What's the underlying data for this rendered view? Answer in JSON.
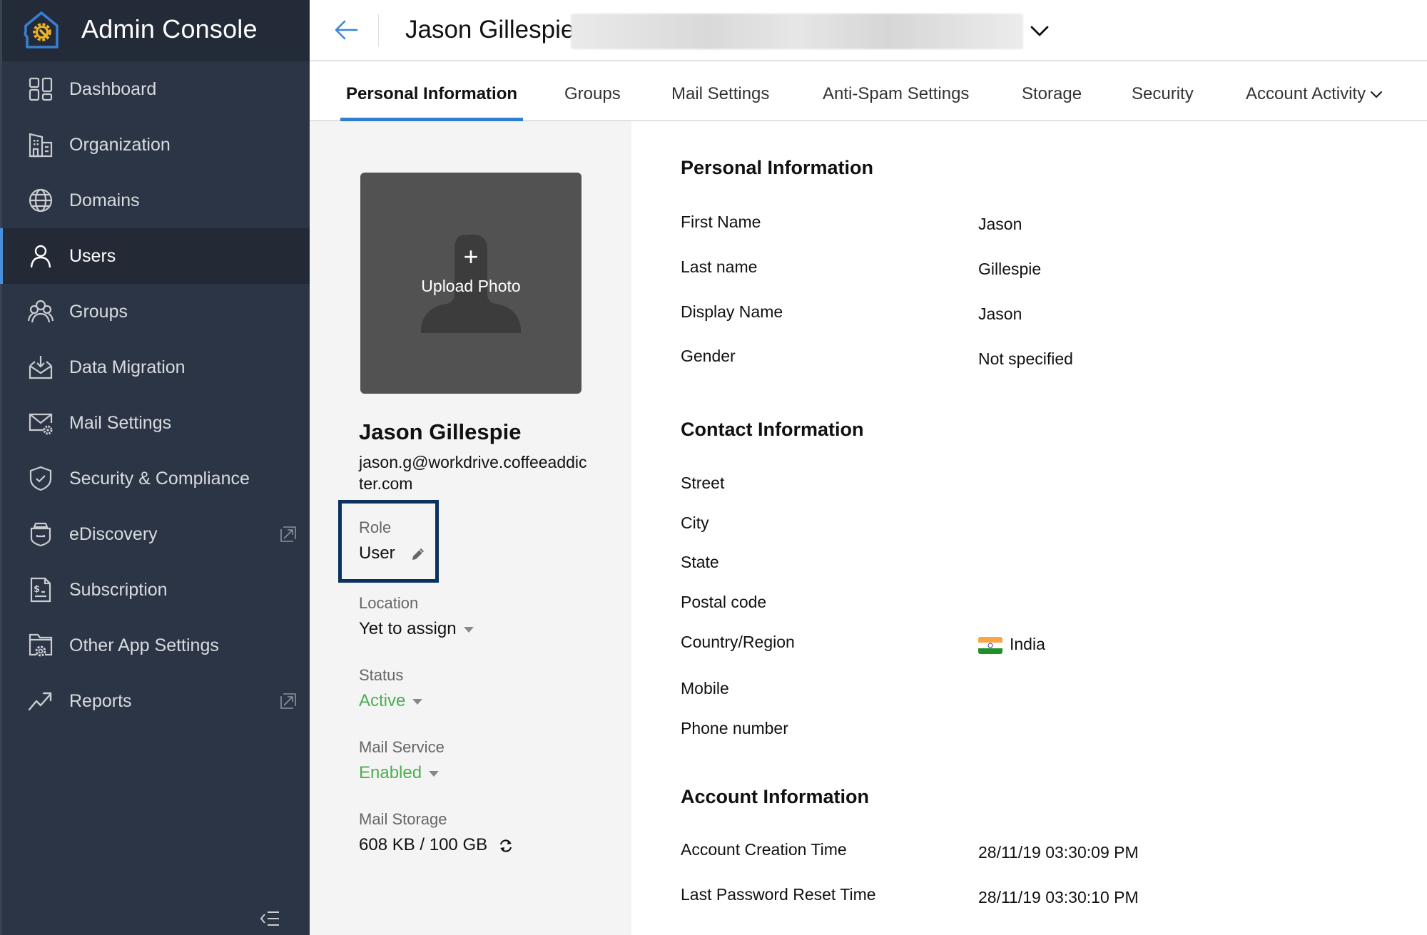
{
  "app": {
    "title": "Admin Console",
    "brand_colors": {
      "logo_outline": "#3b7fd0",
      "logo_gear": "#f0b429",
      "accent": "#2f7fcf",
      "status_green": "#4caf50"
    }
  },
  "sidebar": {
    "items": [
      {
        "label": "Dashboard",
        "icon": "dashboard-icon",
        "active": false,
        "external": false
      },
      {
        "label": "Organization",
        "icon": "building-icon",
        "active": false,
        "external": false
      },
      {
        "label": "Domains",
        "icon": "globe-icon",
        "active": false,
        "external": false
      },
      {
        "label": "Users",
        "icon": "user-icon",
        "active": true,
        "external": false
      },
      {
        "label": "Groups",
        "icon": "groups-icon",
        "active": false,
        "external": false
      },
      {
        "label": "Data Migration",
        "icon": "inbox-download-icon",
        "active": false,
        "external": false
      },
      {
        "label": "Mail Settings",
        "icon": "mail-gear-icon",
        "active": false,
        "external": false
      },
      {
        "label": "Security & Compliance",
        "icon": "shield-check-icon",
        "active": false,
        "external": false
      },
      {
        "label": "eDiscovery",
        "icon": "ediscovery-icon",
        "active": false,
        "external": true
      },
      {
        "label": "Subscription",
        "icon": "invoice-icon",
        "active": false,
        "external": false
      },
      {
        "label": "Other App Settings",
        "icon": "folder-gear-icon",
        "active": false,
        "external": false
      },
      {
        "label": "Reports",
        "icon": "trend-up-icon",
        "active": false,
        "external": true
      }
    ],
    "collapse_icon": "collapse-sidebar-icon"
  },
  "header": {
    "title": "Jason Gillespie",
    "back_icon": "arrow-left-icon",
    "dropdown_icon": "chevron-down-icon"
  },
  "tabs": [
    {
      "label": "Personal Information",
      "active": true
    },
    {
      "label": "Groups",
      "active": false
    },
    {
      "label": "Mail Settings",
      "active": false
    },
    {
      "label": "Anti-Spam Settings",
      "active": false
    },
    {
      "label": "Storage",
      "active": false
    },
    {
      "label": "Security",
      "active": false
    },
    {
      "label": "Account Activity",
      "active": false,
      "has_dropdown": true
    }
  ],
  "profile": {
    "upload_plus": "+",
    "upload_label": "Upload Photo",
    "name": "Jason Gillespie",
    "email": "jason.g@workdrive.coffeeaddicter.com",
    "role": {
      "label": "Role",
      "value": "User"
    },
    "location": {
      "label": "Location",
      "value": "Yet to assign"
    },
    "status": {
      "label": "Status",
      "value": "Active"
    },
    "mail_service": {
      "label": "Mail Service",
      "value": "Enabled"
    },
    "mail_storage": {
      "label": "Mail Storage",
      "value": "608 KB / 100 GB"
    }
  },
  "details": {
    "personal": {
      "title": "Personal Information",
      "rows": [
        {
          "label": "First Name",
          "value": "Jason"
        },
        {
          "label": "Last name",
          "value": "Gillespie"
        },
        {
          "label": "Display Name",
          "value": "Jason"
        },
        {
          "label": "Gender",
          "value": "Not specified"
        }
      ]
    },
    "contact": {
      "title": "Contact Information",
      "rows": [
        {
          "label": "Street",
          "value": ""
        },
        {
          "label": "City",
          "value": ""
        },
        {
          "label": "State",
          "value": ""
        },
        {
          "label": "Postal code",
          "value": ""
        },
        {
          "label": "Country/Region",
          "value": "India",
          "flag": "india-flag-icon"
        },
        {
          "label": "Mobile",
          "value": ""
        },
        {
          "label": "Phone number",
          "value": ""
        }
      ]
    },
    "account": {
      "title": "Account Information",
      "rows": [
        {
          "label": "Account Creation Time",
          "value": "28/11/19 03:30:09 PM"
        },
        {
          "label": "Last Password Reset Time",
          "value": "28/11/19 03:30:10 PM"
        }
      ]
    }
  }
}
